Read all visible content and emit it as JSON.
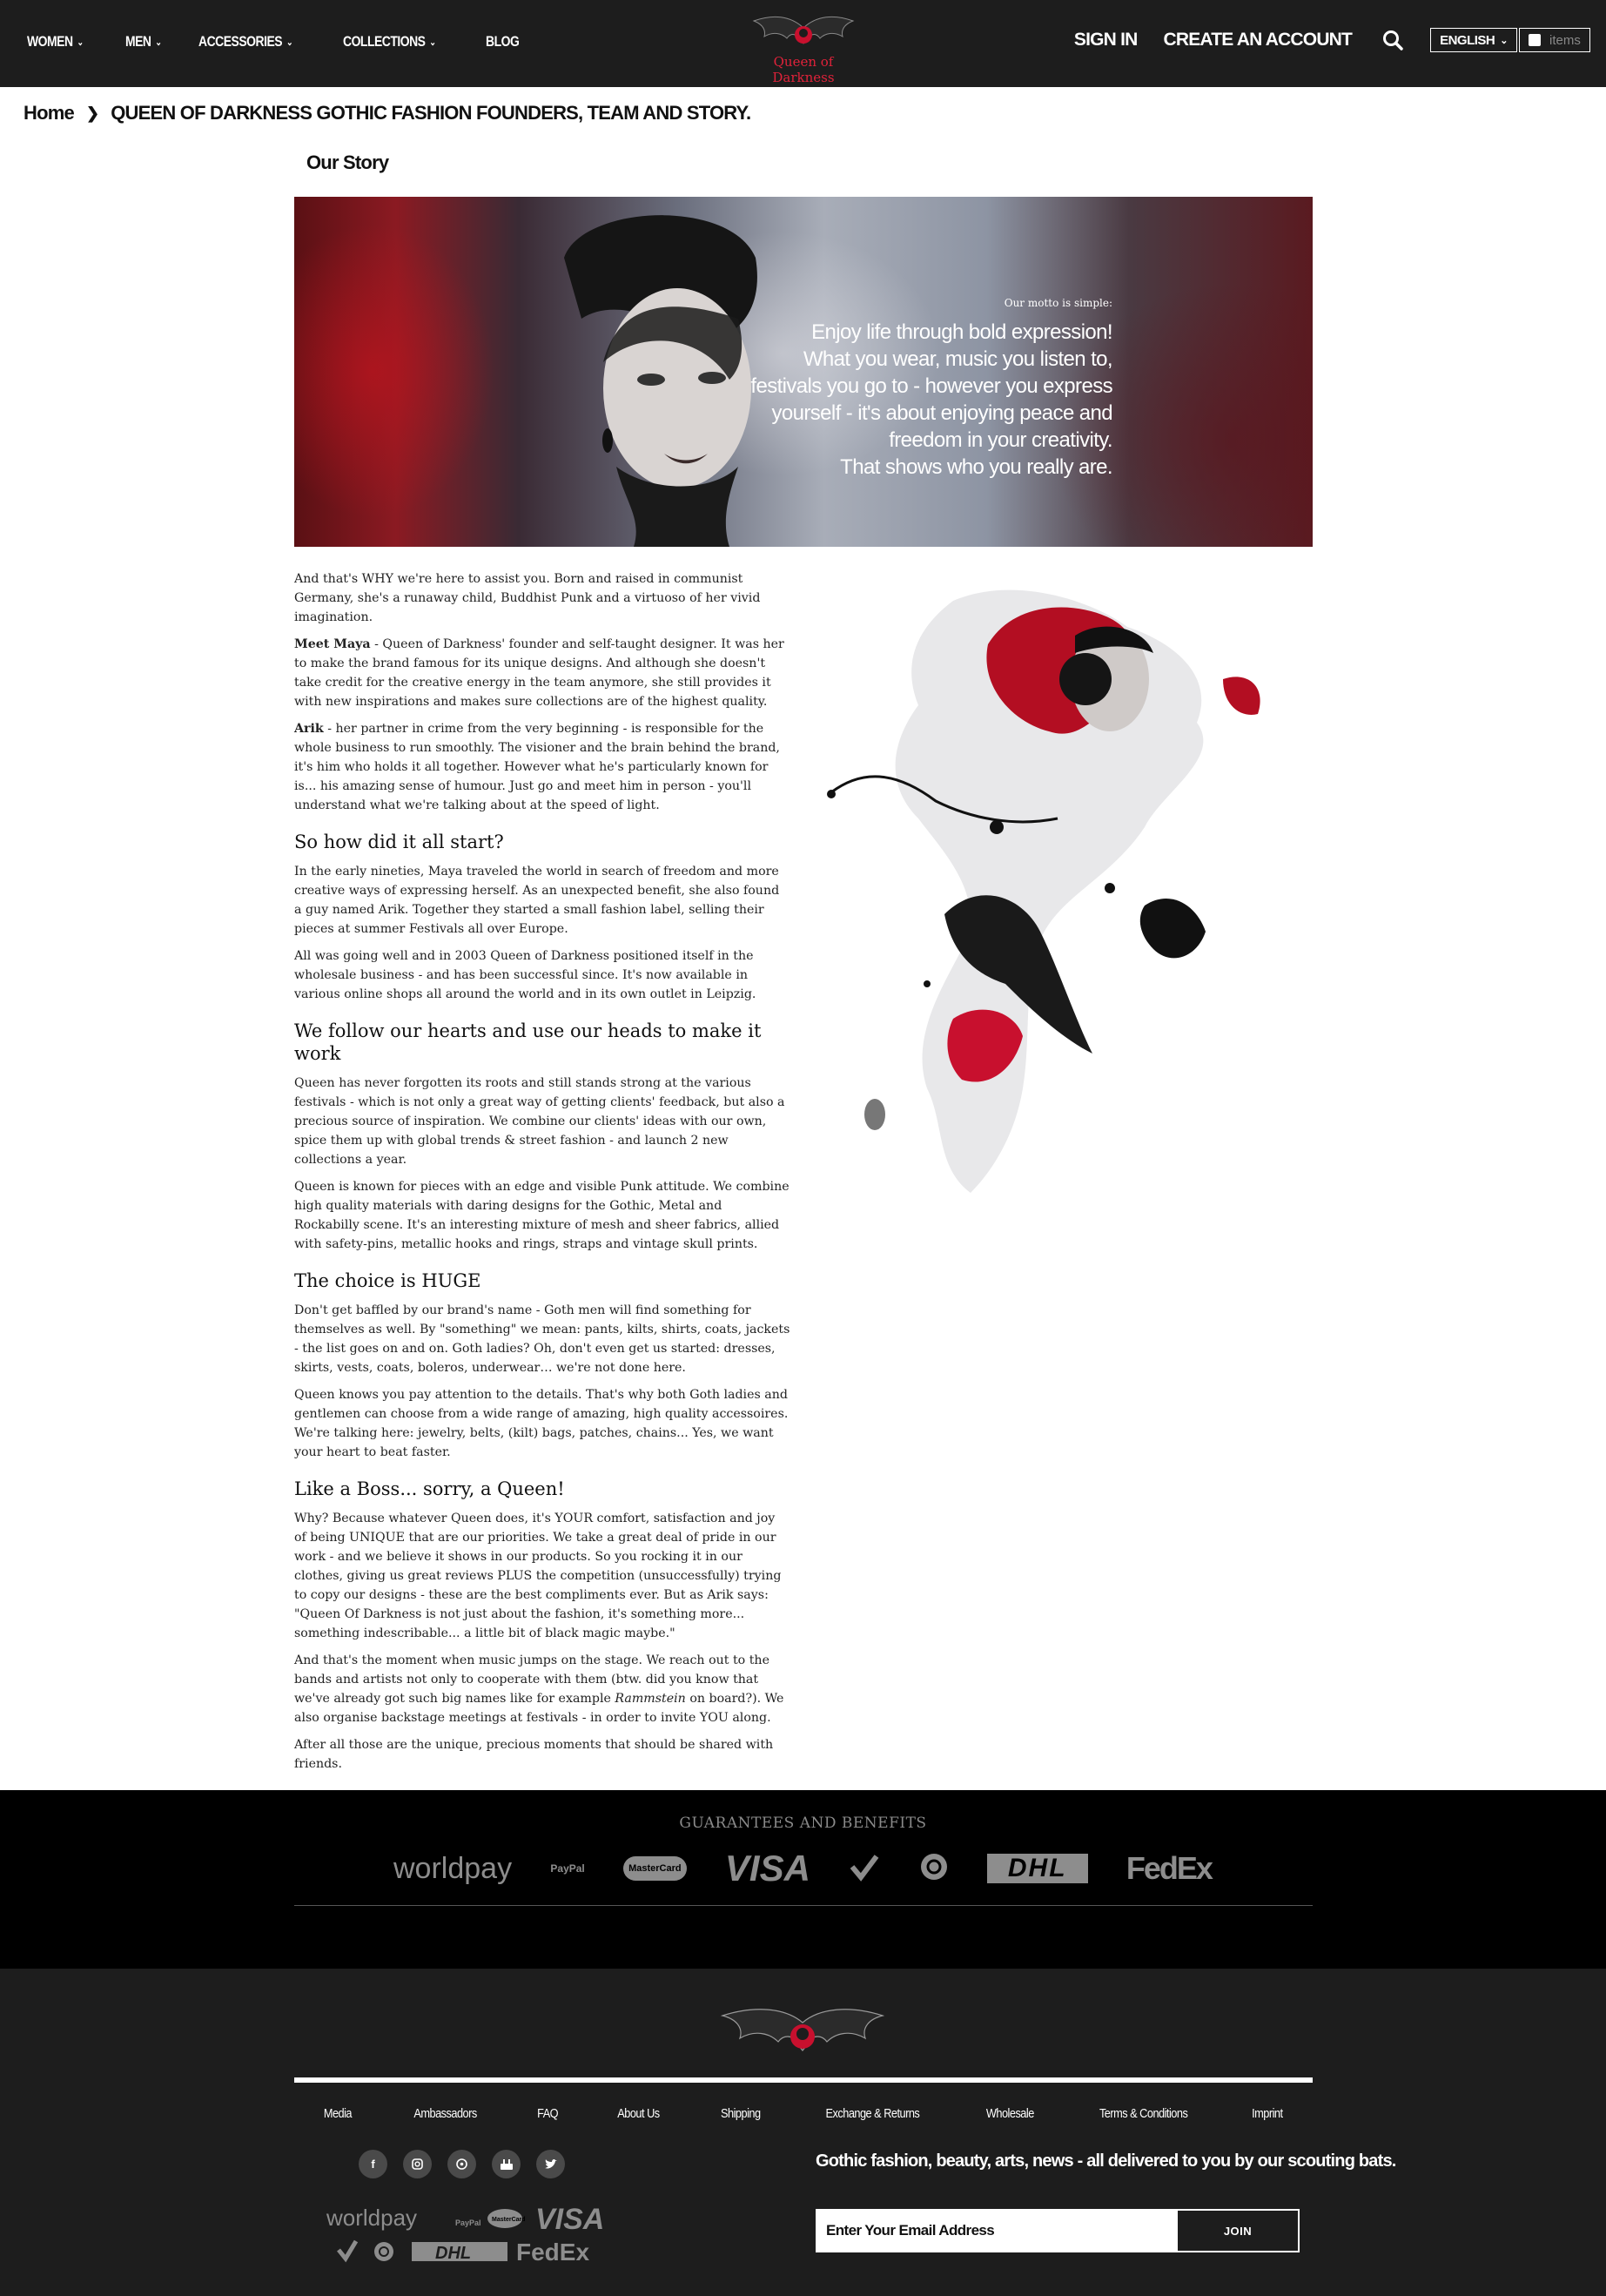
{
  "header": {
    "nav": [
      {
        "label": "WOMEN",
        "has_dropdown": true
      },
      {
        "label": "MEN",
        "has_dropdown": true
      },
      {
        "label": "ACCESSORIES",
        "has_dropdown": true
      },
      {
        "label": "COLLECTIONS",
        "has_dropdown": true
      },
      {
        "label": "BLOG",
        "has_dropdown": false
      }
    ],
    "logo_text": "Queen of Darkness",
    "sign_in": "SIGN IN",
    "create_account": "CREATE AN ACCOUNT",
    "language": "ENGLISH",
    "cart_label": "items"
  },
  "breadcrumb": {
    "home": "Home",
    "current": "QUEEN OF DARKNESS GOTHIC FASHION FOUNDERS, TEAM AND STORY."
  },
  "page": {
    "section_title": "Our Story",
    "hero": {
      "intro": "Our motto is simple:",
      "lines": [
        "Enjoy life through bold expression!",
        "What you wear, music you listen to,",
        "festivals you go to - however you express",
        "yourself - it's about enjoying peace and",
        "freedom in your creativity.",
        "That shows who you really are."
      ]
    },
    "p1": "And that's WHY we're here to assist you. Born and raised in communist Germany, she's a runaway child, Buddhist Punk and a virtuoso of her vivid imagination.",
    "p2_bold": "Meet Maya",
    "p2": " - Queen of Darkness' founder and self-taught designer. It was her to make the brand famous for its unique designs. And although she doesn't take credit for the creative energy in the team anymore, she still provides it with new inspirations and makes sure collections are of the highest quality.",
    "p3_bold": "Arik",
    "p3": " - her partner in crime from the very beginning - is responsible for the whole business to run smoothly. The visioner and the brain behind the brand, it's him who holds it all together. However what he's particularly known for is... his amazing sense of humour. Just go and meet him in person - you'll understand what we're talking about at the speed of light.",
    "h1": "So how did it all start?",
    "p4": "In the early nineties, Maya traveled the world in search of freedom and more creative ways of expressing herself. As an unexpected benefit, she also found a guy named Arik. Together they started a small fashion label, selling their pieces at summer Festivals all over Europe.",
    "p5": "All was going well and in 2003 Queen of Darkness positioned itself in the wholesale business - and has been successful since. It's now available in various online shops all around the world and in its own outlet in Leipzig.",
    "h2": "We follow our hearts and use our heads to make it work",
    "p6": "Queen has never forgotten its roots and still stands strong at the various festivals - which is not only a great way of getting clients' feedback, but also a precious source of inspiration. We combine our clients' ideas with our own, spice them up with global trends & street fashion - and launch 2 new collections a year.",
    "p7": "Queen is known for pieces with an edge and visible Punk attitude. We combine high quality materials with daring designs for the Gothic, Metal and Rockabilly scene. It's an interesting mixture of mesh and sheer fabrics, allied with safety-pins, metallic hooks and rings, straps and vintage skull prints.",
    "h3": "The choice is HUGE",
    "p8": "Don't get baffled by our brand's name - Goth men will find something for themselves as well. By \"something\" we mean: pants, kilts, shirts, coats, jackets - the list goes on and on. Goth ladies? Oh, don't even get us started: dresses, skirts, vests, coats, boleros, underwear… we're not done here.",
    "p9": "Queen knows you pay attention to the details. That's why both Goth ladies and gentlemen can choose from a wide range of amazing, high quality accessoires. We're talking here: jewelry, belts, (kilt) bags, patches, chains... Yes, we want your heart to beat faster.",
    "h4": "Like a Boss... sorry, a Queen!",
    "p10": "Why? Because whatever Queen does, it's YOUR comfort, satisfaction and joy of being UNIQUE that are our priorities. We take a great deal of pride in our work - and we believe it shows in our products. So you rocking it in our clothes, giving us great reviews PLUS the competition (unsuccessfully) trying to copy our designs - these are the best compliments ever. But as Arik says: \"Queen Of Darkness is not just about the fashion, it's something more... something indescribable... a little bit of black magic maybe.\"",
    "p11_a": "And that's the moment when music jumps on the stage. We reach out to the bands and artists not only to cooperate with them (btw. did you know that we've already got such big names like for example ",
    "p11_em": "Rammstein",
    "p11_b": " on board?). We also organise backstage meetings at festivals - in order to invite YOU along.",
    "p12": "After all those are the unique, precious moments that should be shared with friends."
  },
  "guarantees": {
    "title": "GUARANTEES AND BENEFITS",
    "logos": [
      "worldpay",
      "PayPal",
      "MasterCard",
      "VISA",
      "verified",
      "eco",
      "DHL",
      "FedEx"
    ]
  },
  "footer": {
    "links": [
      "Media",
      "Ambassadors",
      "FAQ",
      "About Us",
      "Shipping",
      "Exchange & Returns",
      "Wholesale",
      "Terms & Conditions",
      "Imprint"
    ],
    "social": [
      "f",
      "instagram",
      "pinterest",
      "youtube",
      "twitter"
    ],
    "newsletter_text": "Gothic fashion, beauty, arts, news - all delivered to you by our scouting bats.",
    "email_placeholder": "Enter Your Email Address",
    "join_label": "JOIN"
  },
  "colors": {
    "header_bg": "#1d1d1d",
    "accent_red": "#e0223a",
    "guarantee_bg": "#000000",
    "footer_bg": "#1d1d1d"
  }
}
